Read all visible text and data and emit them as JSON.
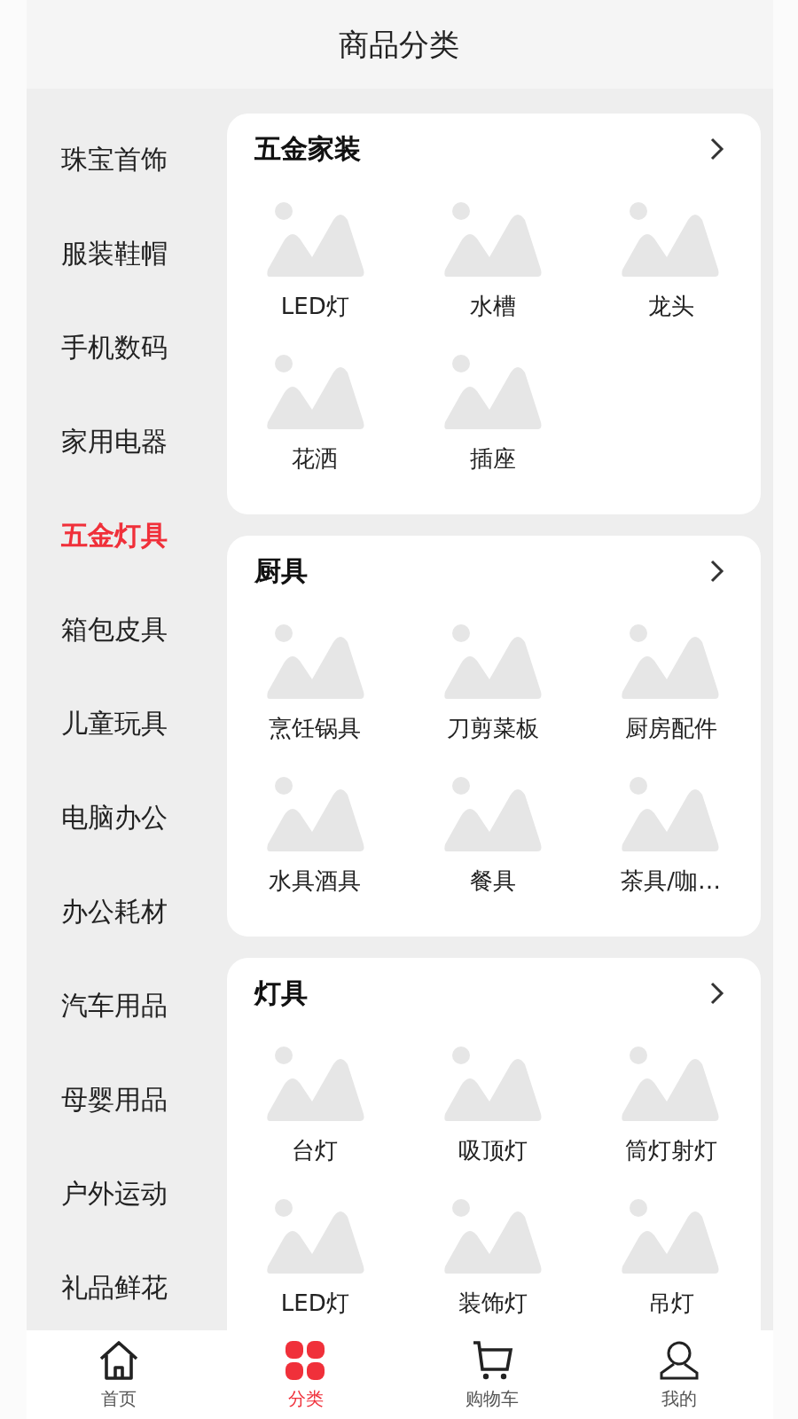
{
  "header": {
    "title": "商品分类"
  },
  "sidebar": {
    "items": [
      {
        "label": "珠宝首饰",
        "selected": false
      },
      {
        "label": "服装鞋帽",
        "selected": false
      },
      {
        "label": "手机数码",
        "selected": false
      },
      {
        "label": "家用电器",
        "selected": false
      },
      {
        "label": "五金灯具",
        "selected": true
      },
      {
        "label": "箱包皮具",
        "selected": false
      },
      {
        "label": "儿童玩具",
        "selected": false
      },
      {
        "label": "电脑办公",
        "selected": false
      },
      {
        "label": "办公耗材",
        "selected": false
      },
      {
        "label": "汽车用品",
        "selected": false
      },
      {
        "label": "母婴用品",
        "selected": false
      },
      {
        "label": "户外运动",
        "selected": false
      },
      {
        "label": "礼品鲜花",
        "selected": false
      }
    ]
  },
  "sections": [
    {
      "title": "五金家装",
      "items": [
        "LED灯",
        "水槽",
        "龙头",
        "花洒",
        "插座"
      ]
    },
    {
      "title": "厨具",
      "items": [
        "烹饪锅具",
        "刀剪菜板",
        "厨房配件",
        "水具酒具",
        "餐具",
        "茶具/咖…"
      ]
    },
    {
      "title": "灯具",
      "items": [
        "台灯",
        "吸顶灯",
        "筒灯射灯",
        "LED灯",
        "装饰灯",
        "吊灯"
      ]
    }
  ],
  "tab_bar": [
    {
      "label": "首页",
      "kind": "home",
      "selected": false
    },
    {
      "label": "分类",
      "kind": "category",
      "selected": true
    },
    {
      "label": "购物车",
      "kind": "cart",
      "selected": false
    },
    {
      "label": "我的",
      "kind": "profile",
      "selected": false
    }
  ]
}
